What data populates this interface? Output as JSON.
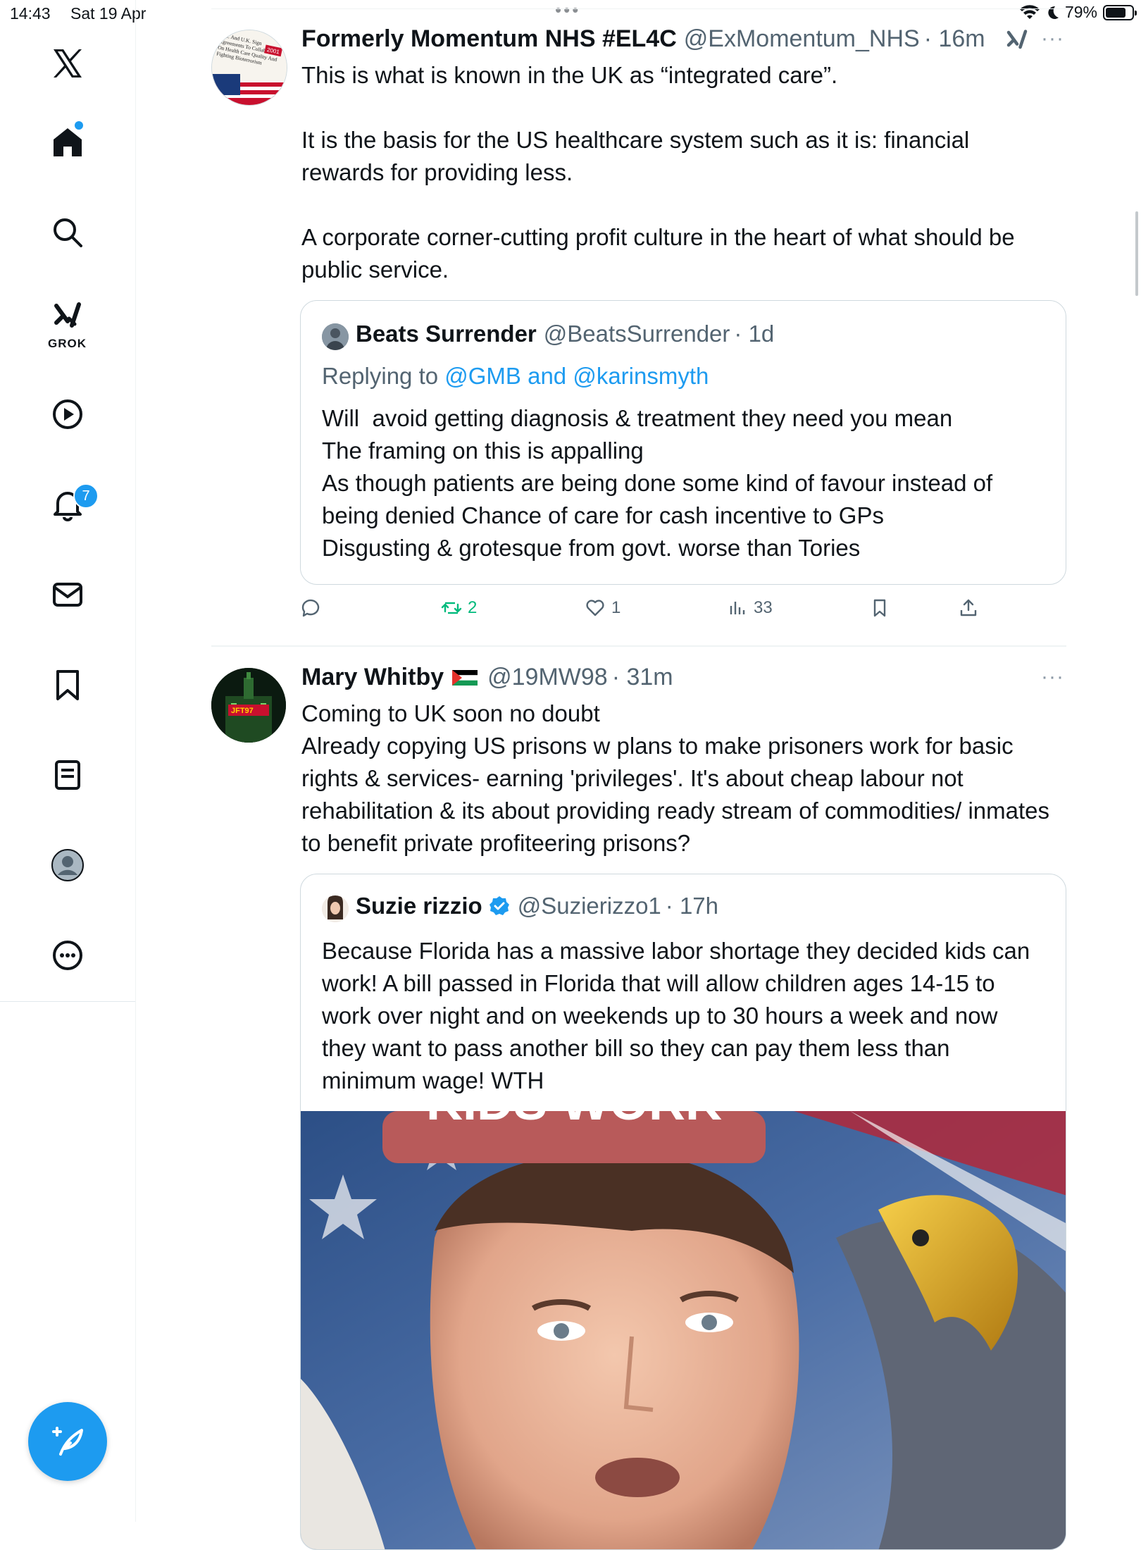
{
  "status_bar": {
    "time": "14:43",
    "date": "Sat 19 Apr",
    "battery": "79%",
    "battery_level": 0.79
  },
  "sidebar": {
    "grok_label": "GROK",
    "notification_count": "7",
    "items": [
      "x-logo",
      "home-icon",
      "search-icon",
      "grok-icon",
      "video-icon",
      "notifications-icon",
      "messages-icon",
      "bookmarks-icon",
      "lists-icon",
      "profile-icon",
      "more-icon"
    ]
  },
  "tweets": [
    {
      "name": "Formerly Momentum NHS #EL4C",
      "handle": "@ExMomentum_NHS",
      "time": "· 16m",
      "avatar_text": "U.S. And U.K. Sign Agreements To Collaborate On Health Care Quality And Fighting Bioterrorism",
      "avatar_year": "2001",
      "text": "This is what is known in the UK as “integrated care”.\n\nIt is the basis for the US healthcare system such as it is: financial rewards for providing less.\n\nA corporate corner-cutting profit culture in the heart of what should be public service.",
      "quote": {
        "name": "Beats Surrender",
        "handle": "@BeatsSurrender",
        "time": "· 1d",
        "replying_prefix": "Replying to ",
        "replying_to": "@GMB and @karinsmyth",
        "text": "Will  avoid getting diagnosis & treatment they need you mean\nThe framing on this is appalling\nAs though patients are being done some kind of favour instead of being denied Chance of care for cash incentive to GPs\nDisgusting & grotesque from govt. worse than Tories"
      },
      "actions": {
        "replies": "",
        "reposts": "2",
        "likes": "1",
        "views": "33"
      }
    },
    {
      "name": "Mary Whitby",
      "flag": "palestine-flag",
      "handle": "@19MW98",
      "time": "· 31m",
      "avatar_text": "JFT97",
      "text": "Coming to UK soon no doubt\nAlready copying US prisons w plans to make prisoners work for basic rights & services- earning 'privileges'. It's about cheap labour not rehabilitation & its about providing ready stream of commodities/ inmates to benefit private profiteering prisons?",
      "quote": {
        "name": "Suzie rizzio",
        "verified": true,
        "handle": "@Suzierizzo1",
        "time": "· 17h",
        "text": "Because Florida has a massive labor shortage they decided kids can work! A bill passed in Florida that will allow children ages 14-15 to work over night and on weekends up to 30 hours a week and now they want to pass another bill so they can pay them less than minimum wage! WTH",
        "media_banner_text": "KIDS WORK"
      }
    }
  ],
  "colors": {
    "accent": "#1d9bf0",
    "text": "#0f1419",
    "secondary": "#536471",
    "repost_green": "#00ba7c",
    "border": "#cfd9de"
  }
}
